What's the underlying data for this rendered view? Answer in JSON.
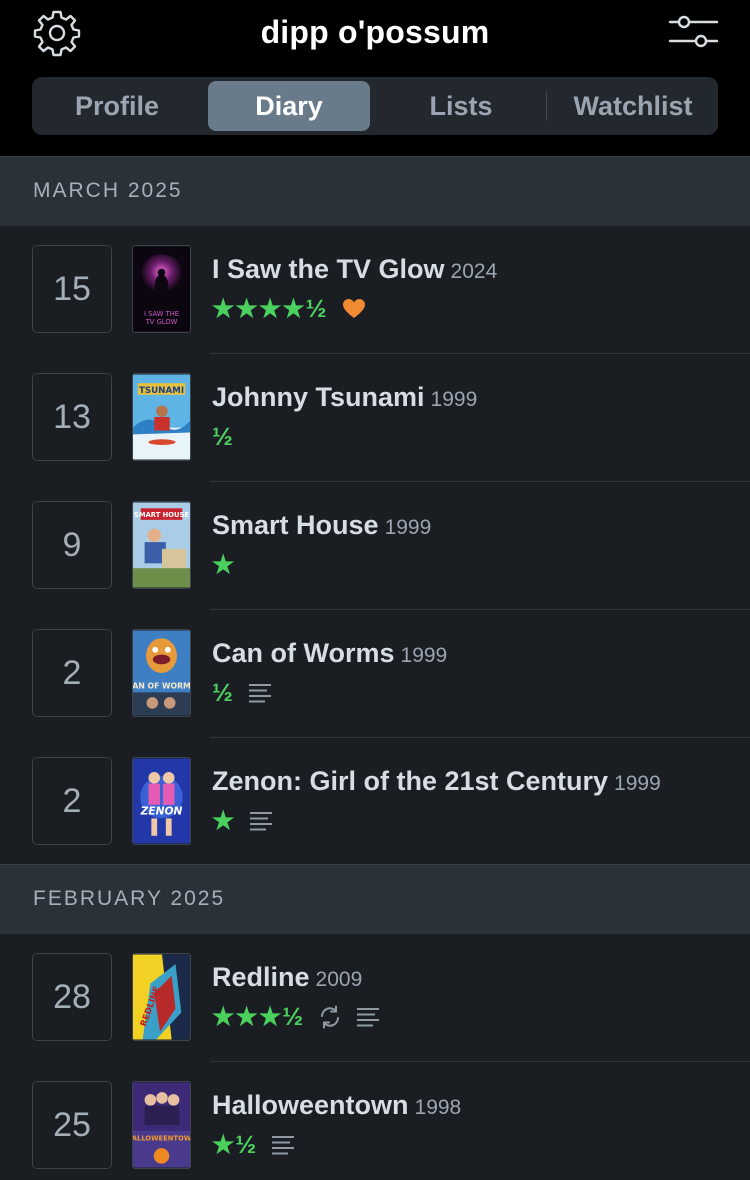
{
  "header": {
    "title": "dipp o'possum",
    "left_icon": "gear-icon",
    "right_icon": "filter-sliders-icon"
  },
  "tabs": [
    {
      "label": "Profile",
      "active": false
    },
    {
      "label": "Diary",
      "active": true
    },
    {
      "label": "Lists",
      "active": false
    },
    {
      "label": "Watchlist",
      "active": false
    }
  ],
  "colors": {
    "background": "#14181c",
    "star_green": "#4bd05e",
    "like_orange": "#f08a33",
    "active_tab": "#697a8a"
  },
  "months": [
    {
      "label": "MARCH 2025",
      "entries": [
        {
          "day": "15",
          "title": "I Saw the TV Glow",
          "year": "2024",
          "rating": "★★★★½",
          "liked": true,
          "rewatch": false,
          "review": false,
          "poster": "i-saw-the-tv-glow-poster"
        },
        {
          "day": "13",
          "title": "Johnny Tsunami",
          "year": "1999",
          "rating": "½",
          "liked": false,
          "rewatch": false,
          "review": false,
          "poster": "johnny-tsunami-poster"
        },
        {
          "day": "9",
          "title": "Smart House",
          "year": "1999",
          "rating": "★",
          "liked": false,
          "rewatch": false,
          "review": false,
          "poster": "smart-house-poster"
        },
        {
          "day": "2",
          "title": "Can of Worms",
          "year": "1999",
          "rating": "½",
          "liked": false,
          "rewatch": false,
          "review": true,
          "poster": "can-of-worms-poster"
        },
        {
          "day": "2",
          "title": "Zenon: Girl of the 21st Century",
          "year": "1999",
          "rating": "★",
          "liked": false,
          "rewatch": false,
          "review": true,
          "poster": "zenon-poster"
        }
      ]
    },
    {
      "label": "FEBRUARY 2025",
      "entries": [
        {
          "day": "28",
          "title": "Redline",
          "year": "2009",
          "rating": "★★★½",
          "liked": false,
          "rewatch": true,
          "review": true,
          "poster": "redline-poster"
        },
        {
          "day": "25",
          "title": "Halloweentown",
          "year": "1998",
          "rating": "★½",
          "liked": false,
          "rewatch": false,
          "review": true,
          "poster": "halloweentown-poster"
        }
      ]
    }
  ]
}
